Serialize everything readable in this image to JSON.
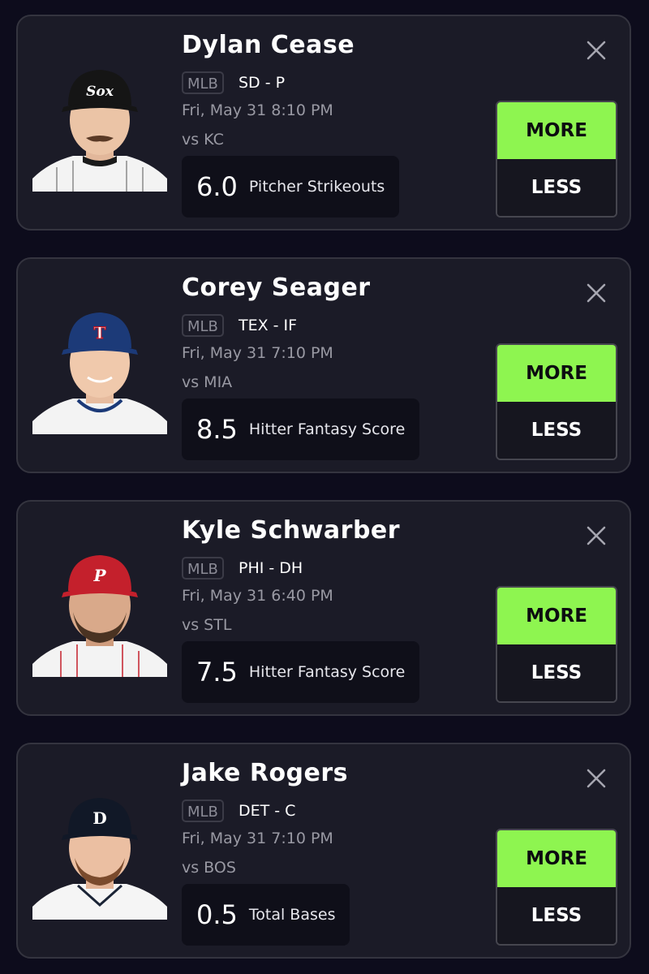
{
  "cards": [
    {
      "name": "Dylan Cease",
      "league": "MLB",
      "team_position": "SD - P",
      "game_time": "Fri, May 31 8:10 PM",
      "opponent": "vs KC",
      "projection_value": "6.0",
      "projection_stat": "Pitcher Strikeouts",
      "more_label": "MORE",
      "less_label": "LESS",
      "photo": {
        "cap_color": "#151515",
        "jersey_color": "#f3f3f3",
        "logo": "Sox"
      }
    },
    {
      "name": "Corey Seager",
      "league": "MLB",
      "team_position": "TEX - IF",
      "game_time": "Fri, May 31 7:10 PM",
      "opponent": "vs MIA",
      "projection_value": "8.5",
      "projection_stat": "Hitter Fantasy Score",
      "more_label": "MORE",
      "less_label": "LESS",
      "photo": {
        "cap_color": "#1c3a78",
        "jersey_color": "#f3f3f3",
        "logo": "T"
      }
    },
    {
      "name": "Kyle Schwarber",
      "league": "MLB",
      "team_position": "PHI - DH",
      "game_time": "Fri, May 31 6:40 PM",
      "opponent": "vs STL",
      "projection_value": "7.5",
      "projection_stat": "Hitter Fantasy Score",
      "more_label": "MORE",
      "less_label": "LESS",
      "photo": {
        "cap_color": "#c4202c",
        "jersey_color": "#f3f3f3",
        "logo": "P"
      }
    },
    {
      "name": "Jake Rogers",
      "league": "MLB",
      "team_position": "DET - C",
      "game_time": "Fri, May 31 7:10 PM",
      "opponent": "vs BOS",
      "projection_value": "0.5",
      "projection_stat": "Total Bases",
      "more_label": "MORE",
      "less_label": "LESS",
      "photo": {
        "cap_color": "#111827",
        "jersey_color": "#f5f5f5",
        "logo": "D"
      }
    }
  ],
  "icons": {
    "close": "close-icon",
    "photo": "player-photo"
  },
  "colors": {
    "more_button": "#8ef550",
    "background": "#0d0c1c",
    "card": "#1b1b27"
  }
}
